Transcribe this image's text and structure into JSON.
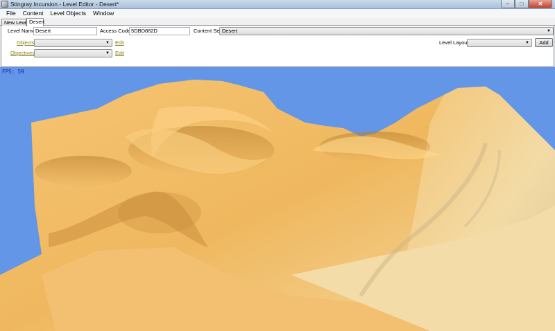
{
  "window": {
    "title": "Stingray Incursion - Level Editor - Desert*",
    "minimize_glyph": "–",
    "maximize_glyph": "□",
    "close_glyph": "✕"
  },
  "menu": [
    "File",
    "Content",
    "Level Objects",
    "Window"
  ],
  "tabs": [
    "New Level*",
    "Desert"
  ],
  "fields": {
    "level_name_label": "Level Name",
    "level_name_value": "Desert",
    "access_code_label": "Access Code",
    "access_code_value": "5DBD882D",
    "content_set_label": "Content Set",
    "content_set_value": "Desert"
  },
  "objects": {
    "label": "Objects",
    "value": "",
    "edit": "Edit"
  },
  "objectives": {
    "label": "Objectives",
    "value": "",
    "edit": "Edit"
  },
  "level_layout": {
    "label": "Level Layout",
    "value": "",
    "add": "Add"
  },
  "viewport": {
    "fps_label": "FPS: 59",
    "sky_color": "#6496e8",
    "sand_color": "#f0b860"
  }
}
